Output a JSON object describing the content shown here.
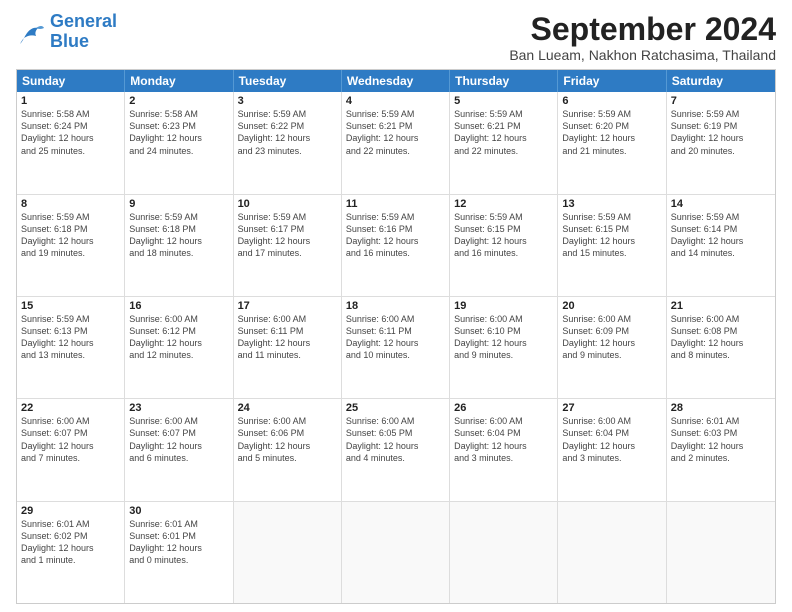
{
  "logo": {
    "line1": "General",
    "line2": "Blue"
  },
  "title": "September 2024",
  "subtitle": "Ban Lueam, Nakhon Ratchasima, Thailand",
  "days": [
    "Sunday",
    "Monday",
    "Tuesday",
    "Wednesday",
    "Thursday",
    "Friday",
    "Saturday"
  ],
  "rows": [
    [
      {
        "day": "1",
        "lines": [
          "Sunrise: 5:58 AM",
          "Sunset: 6:24 PM",
          "Daylight: 12 hours",
          "and 25 minutes."
        ]
      },
      {
        "day": "2",
        "lines": [
          "Sunrise: 5:58 AM",
          "Sunset: 6:23 PM",
          "Daylight: 12 hours",
          "and 24 minutes."
        ]
      },
      {
        "day": "3",
        "lines": [
          "Sunrise: 5:59 AM",
          "Sunset: 6:22 PM",
          "Daylight: 12 hours",
          "and 23 minutes."
        ]
      },
      {
        "day": "4",
        "lines": [
          "Sunrise: 5:59 AM",
          "Sunset: 6:21 PM",
          "Daylight: 12 hours",
          "and 22 minutes."
        ]
      },
      {
        "day": "5",
        "lines": [
          "Sunrise: 5:59 AM",
          "Sunset: 6:21 PM",
          "Daylight: 12 hours",
          "and 22 minutes."
        ]
      },
      {
        "day": "6",
        "lines": [
          "Sunrise: 5:59 AM",
          "Sunset: 6:20 PM",
          "Daylight: 12 hours",
          "and 21 minutes."
        ]
      },
      {
        "day": "7",
        "lines": [
          "Sunrise: 5:59 AM",
          "Sunset: 6:19 PM",
          "Daylight: 12 hours",
          "and 20 minutes."
        ]
      }
    ],
    [
      {
        "day": "8",
        "lines": [
          "Sunrise: 5:59 AM",
          "Sunset: 6:18 PM",
          "Daylight: 12 hours",
          "and 19 minutes."
        ]
      },
      {
        "day": "9",
        "lines": [
          "Sunrise: 5:59 AM",
          "Sunset: 6:18 PM",
          "Daylight: 12 hours",
          "and 18 minutes."
        ]
      },
      {
        "day": "10",
        "lines": [
          "Sunrise: 5:59 AM",
          "Sunset: 6:17 PM",
          "Daylight: 12 hours",
          "and 17 minutes."
        ]
      },
      {
        "day": "11",
        "lines": [
          "Sunrise: 5:59 AM",
          "Sunset: 6:16 PM",
          "Daylight: 12 hours",
          "and 16 minutes."
        ]
      },
      {
        "day": "12",
        "lines": [
          "Sunrise: 5:59 AM",
          "Sunset: 6:15 PM",
          "Daylight: 12 hours",
          "and 16 minutes."
        ]
      },
      {
        "day": "13",
        "lines": [
          "Sunrise: 5:59 AM",
          "Sunset: 6:15 PM",
          "Daylight: 12 hours",
          "and 15 minutes."
        ]
      },
      {
        "day": "14",
        "lines": [
          "Sunrise: 5:59 AM",
          "Sunset: 6:14 PM",
          "Daylight: 12 hours",
          "and 14 minutes."
        ]
      }
    ],
    [
      {
        "day": "15",
        "lines": [
          "Sunrise: 5:59 AM",
          "Sunset: 6:13 PM",
          "Daylight: 12 hours",
          "and 13 minutes."
        ]
      },
      {
        "day": "16",
        "lines": [
          "Sunrise: 6:00 AM",
          "Sunset: 6:12 PM",
          "Daylight: 12 hours",
          "and 12 minutes."
        ]
      },
      {
        "day": "17",
        "lines": [
          "Sunrise: 6:00 AM",
          "Sunset: 6:11 PM",
          "Daylight: 12 hours",
          "and 11 minutes."
        ]
      },
      {
        "day": "18",
        "lines": [
          "Sunrise: 6:00 AM",
          "Sunset: 6:11 PM",
          "Daylight: 12 hours",
          "and 10 minutes."
        ]
      },
      {
        "day": "19",
        "lines": [
          "Sunrise: 6:00 AM",
          "Sunset: 6:10 PM",
          "Daylight: 12 hours",
          "and 9 minutes."
        ]
      },
      {
        "day": "20",
        "lines": [
          "Sunrise: 6:00 AM",
          "Sunset: 6:09 PM",
          "Daylight: 12 hours",
          "and 9 minutes."
        ]
      },
      {
        "day": "21",
        "lines": [
          "Sunrise: 6:00 AM",
          "Sunset: 6:08 PM",
          "Daylight: 12 hours",
          "and 8 minutes."
        ]
      }
    ],
    [
      {
        "day": "22",
        "lines": [
          "Sunrise: 6:00 AM",
          "Sunset: 6:07 PM",
          "Daylight: 12 hours",
          "and 7 minutes."
        ]
      },
      {
        "day": "23",
        "lines": [
          "Sunrise: 6:00 AM",
          "Sunset: 6:07 PM",
          "Daylight: 12 hours",
          "and 6 minutes."
        ]
      },
      {
        "day": "24",
        "lines": [
          "Sunrise: 6:00 AM",
          "Sunset: 6:06 PM",
          "Daylight: 12 hours",
          "and 5 minutes."
        ]
      },
      {
        "day": "25",
        "lines": [
          "Sunrise: 6:00 AM",
          "Sunset: 6:05 PM",
          "Daylight: 12 hours",
          "and 4 minutes."
        ]
      },
      {
        "day": "26",
        "lines": [
          "Sunrise: 6:00 AM",
          "Sunset: 6:04 PM",
          "Daylight: 12 hours",
          "and 3 minutes."
        ]
      },
      {
        "day": "27",
        "lines": [
          "Sunrise: 6:00 AM",
          "Sunset: 6:04 PM",
          "Daylight: 12 hours",
          "and 3 minutes."
        ]
      },
      {
        "day": "28",
        "lines": [
          "Sunrise: 6:01 AM",
          "Sunset: 6:03 PM",
          "Daylight: 12 hours",
          "and 2 minutes."
        ]
      }
    ],
    [
      {
        "day": "29",
        "lines": [
          "Sunrise: 6:01 AM",
          "Sunset: 6:02 PM",
          "Daylight: 12 hours",
          "and 1 minute."
        ]
      },
      {
        "day": "30",
        "lines": [
          "Sunrise: 6:01 AM",
          "Sunset: 6:01 PM",
          "Daylight: 12 hours",
          "and 0 minutes."
        ]
      },
      {
        "day": "",
        "lines": []
      },
      {
        "day": "",
        "lines": []
      },
      {
        "day": "",
        "lines": []
      },
      {
        "day": "",
        "lines": []
      },
      {
        "day": "",
        "lines": []
      }
    ]
  ]
}
